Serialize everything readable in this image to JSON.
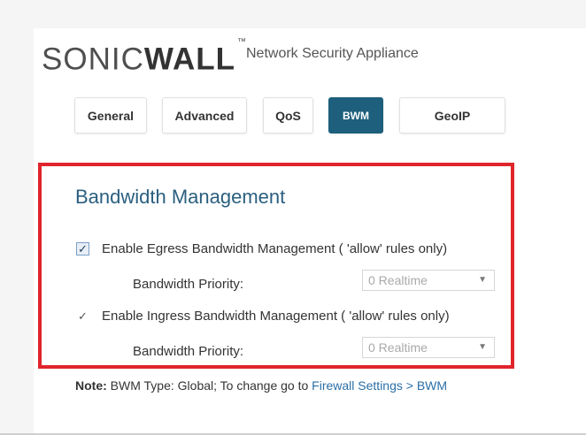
{
  "header": {
    "brand_light": "SONIC",
    "brand_bold": "WALL",
    "brand_tm": "™",
    "product": "Network Security Appliance"
  },
  "tabs": [
    {
      "label": "General",
      "active": false
    },
    {
      "label": "Advanced",
      "active": false
    },
    {
      "label": "QoS",
      "active": false
    },
    {
      "label": "BWM",
      "active": true
    },
    {
      "label": "GeoIP",
      "active": false
    }
  ],
  "bwm": {
    "heading": "Bandwidth Management",
    "egress": {
      "checked": true,
      "label": "Enable Egress Bandwidth Management ( 'allow' rules only)",
      "priority_label": "Bandwidth Priority:",
      "priority_value": "0 Realtime"
    },
    "ingress": {
      "checked": true,
      "label": "Enable Ingress Bandwidth Management ( 'allow' rules only)",
      "priority_label": "Bandwidth Priority:",
      "priority_value": "0 Realtime"
    }
  },
  "note": {
    "prefix": "Note:",
    "text": " BWM Type: Global; To change go to ",
    "link": "Firewall Settings > BWM"
  },
  "colors": {
    "accent": "#1d5f7c",
    "highlight_border": "#e0242b",
    "heading": "#2a5f7f",
    "link": "#2a6ea6"
  }
}
